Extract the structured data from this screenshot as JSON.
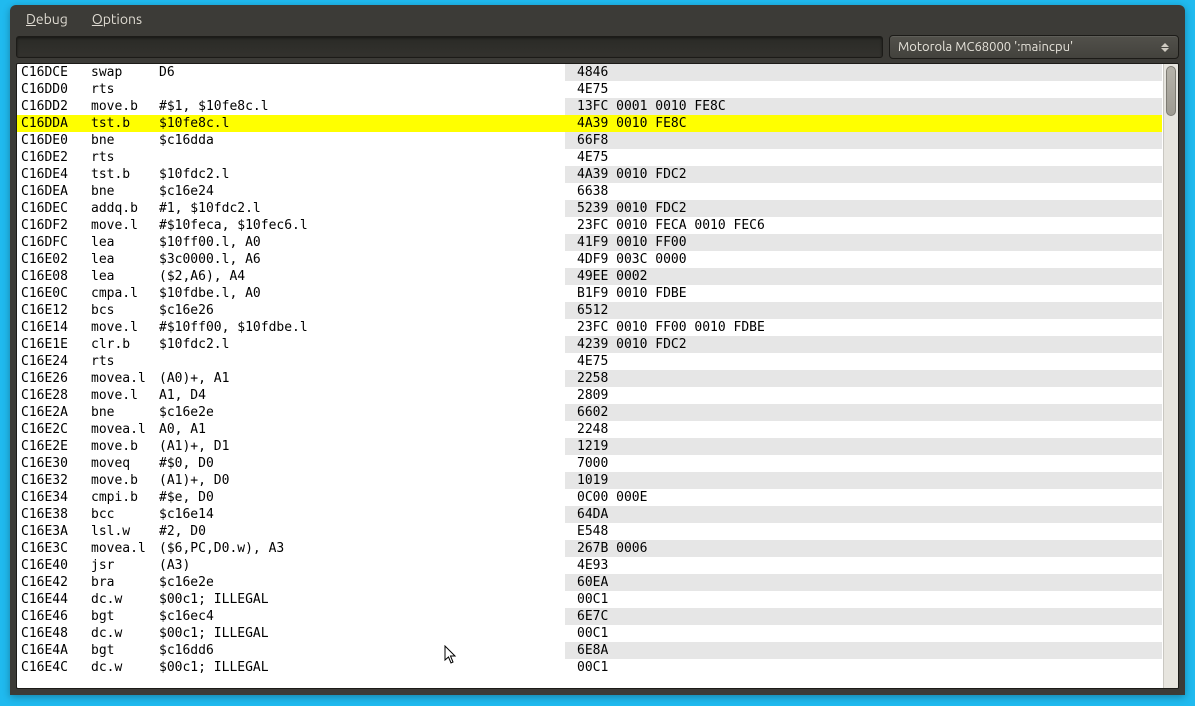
{
  "menubar": {
    "debug": "Debug",
    "options": "Options"
  },
  "cpu_selector": "Motorola MC68000 ':maincpu'",
  "rows": [
    {
      "addr": "C16DCE",
      "op": "swap",
      "args": "D6",
      "hex": "4846",
      "hl": false
    },
    {
      "addr": "C16DD0",
      "op": "rts",
      "args": "",
      "hex": "4E75",
      "hl": false
    },
    {
      "addr": "C16DD2",
      "op": "move.b",
      "args": "#$1, $10fe8c.l",
      "hex": "13FC 0001 0010 FE8C",
      "hl": false
    },
    {
      "addr": "C16DDA",
      "op": "tst.b",
      "args": "$10fe8c.l",
      "hex": "4A39 0010 FE8C",
      "hl": true
    },
    {
      "addr": "C16DE0",
      "op": "bne",
      "args": "$c16dda",
      "hex": "66F8",
      "hl": false
    },
    {
      "addr": "C16DE2",
      "op": "rts",
      "args": "",
      "hex": "4E75",
      "hl": false
    },
    {
      "addr": "C16DE4",
      "op": "tst.b",
      "args": "$10fdc2.l",
      "hex": "4A39 0010 FDC2",
      "hl": false
    },
    {
      "addr": "C16DEA",
      "op": "bne",
      "args": "$c16e24",
      "hex": "6638",
      "hl": false
    },
    {
      "addr": "C16DEC",
      "op": "addq.b",
      "args": "#1, $10fdc2.l",
      "hex": "5239 0010 FDC2",
      "hl": false
    },
    {
      "addr": "C16DF2",
      "op": "move.l",
      "args": "#$10feca, $10fec6.l",
      "hex": "23FC 0010 FECA 0010 FEC6",
      "hl": false
    },
    {
      "addr": "C16DFC",
      "op": "lea",
      "args": "$10ff00.l, A0",
      "hex": "41F9 0010 FF00",
      "hl": false
    },
    {
      "addr": "C16E02",
      "op": "lea",
      "args": "$3c0000.l, A6",
      "hex": "4DF9 003C 0000",
      "hl": false
    },
    {
      "addr": "C16E08",
      "op": "lea",
      "args": "($2,A6), A4",
      "hex": "49EE 0002",
      "hl": false
    },
    {
      "addr": "C16E0C",
      "op": "cmpa.l",
      "args": "$10fdbe.l, A0",
      "hex": "B1F9 0010 FDBE",
      "hl": false
    },
    {
      "addr": "C16E12",
      "op": "bcs",
      "args": "$c16e26",
      "hex": "6512",
      "hl": false
    },
    {
      "addr": "C16E14",
      "op": "move.l",
      "args": "#$10ff00, $10fdbe.l",
      "hex": "23FC 0010 FF00 0010 FDBE",
      "hl": false
    },
    {
      "addr": "C16E1E",
      "op": "clr.b",
      "args": "$10fdc2.l",
      "hex": "4239 0010 FDC2",
      "hl": false
    },
    {
      "addr": "C16E24",
      "op": "rts",
      "args": "",
      "hex": "4E75",
      "hl": false
    },
    {
      "addr": "C16E26",
      "op": "movea.l",
      "args": "(A0)+, A1",
      "hex": "2258",
      "hl": false
    },
    {
      "addr": "C16E28",
      "op": "move.l",
      "args": "A1, D4",
      "hex": "2809",
      "hl": false
    },
    {
      "addr": "C16E2A",
      "op": "bne",
      "args": "$c16e2e",
      "hex": "6602",
      "hl": false
    },
    {
      "addr": "C16E2C",
      "op": "movea.l",
      "args": "A0, A1",
      "hex": "2248",
      "hl": false
    },
    {
      "addr": "C16E2E",
      "op": "move.b",
      "args": "(A1)+, D1",
      "hex": "1219",
      "hl": false
    },
    {
      "addr": "C16E30",
      "op": "moveq",
      "args": "#$0, D0",
      "hex": "7000",
      "hl": false
    },
    {
      "addr": "C16E32",
      "op": "move.b",
      "args": "(A1)+, D0",
      "hex": "1019",
      "hl": false
    },
    {
      "addr": "C16E34",
      "op": "cmpi.b",
      "args": "#$e, D0",
      "hex": "0C00 000E",
      "hl": false
    },
    {
      "addr": "C16E38",
      "op": "bcc",
      "args": "$c16e14",
      "hex": "64DA",
      "hl": false
    },
    {
      "addr": "C16E3A",
      "op": "lsl.w",
      "args": "#2, D0",
      "hex": "E548",
      "hl": false
    },
    {
      "addr": "C16E3C",
      "op": "movea.l",
      "args": "($6,PC,D0.w), A3",
      "hex": "267B 0006",
      "hl": false
    },
    {
      "addr": "C16E40",
      "op": "jsr",
      "args": "(A3)",
      "hex": "4E93",
      "hl": false
    },
    {
      "addr": "C16E42",
      "op": "bra",
      "args": "$c16e2e",
      "hex": "60EA",
      "hl": false
    },
    {
      "addr": "C16E44",
      "op": "dc.w",
      "args": "$00c1; ILLEGAL",
      "hex": "00C1",
      "hl": false
    },
    {
      "addr": "C16E46",
      "op": "bgt",
      "args": "$c16ec4",
      "hex": "6E7C",
      "hl": false
    },
    {
      "addr": "C16E48",
      "op": "dc.w",
      "args": "$00c1; ILLEGAL",
      "hex": "00C1",
      "hl": false
    },
    {
      "addr": "C16E4A",
      "op": "bgt",
      "args": "$c16dd6",
      "hex": "6E8A",
      "hl": false
    },
    {
      "addr": "C16E4C",
      "op": "dc.w",
      "args": "$00c1; ILLEGAL",
      "hex": "00C1",
      "hl": false
    }
  ]
}
